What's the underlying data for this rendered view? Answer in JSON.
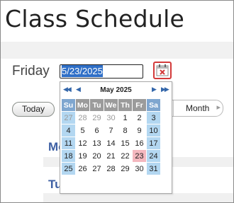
{
  "page": {
    "title": "Class Schedule"
  },
  "date_picker": {
    "day_label": "Friday",
    "input_value": "5/23/2025",
    "calendar_button_icon": "calendar-close-icon"
  },
  "toolbar": {
    "today_label": "Today",
    "view_label": "Month",
    "view_arrow_icon": "chevron-right-icon"
  },
  "schedule": {
    "day1_label": "Mo",
    "day2_label": "Tu"
  },
  "calendar": {
    "month_title": "May 2025",
    "nav": {
      "prev_year": "◀◀",
      "prev_month": "◀",
      "next_month": "▶",
      "next_year": "▶▶"
    },
    "weekdays": [
      "Su",
      "Mo",
      "Tu",
      "We",
      "Th",
      "Fr",
      "Sa"
    ],
    "weeks": [
      [
        "27",
        "28",
        "29",
        "30",
        "1",
        "2",
        "3"
      ],
      [
        "4",
        "5",
        "6",
        "7",
        "8",
        "9",
        "10"
      ],
      [
        "11",
        "12",
        "13",
        "14",
        "15",
        "16",
        "17"
      ],
      [
        "18",
        "19",
        "20",
        "21",
        "22",
        "23",
        "24"
      ],
      [
        "25",
        "26",
        "27",
        "28",
        "29",
        "30",
        "31"
      ]
    ],
    "selected_day": "23",
    "colors": {
      "weekend_header": "#7fa6cf",
      "weekend_cell": "#b3d7f1",
      "header": "#9b9b9b",
      "selected": "#f4b8bf"
    }
  }
}
